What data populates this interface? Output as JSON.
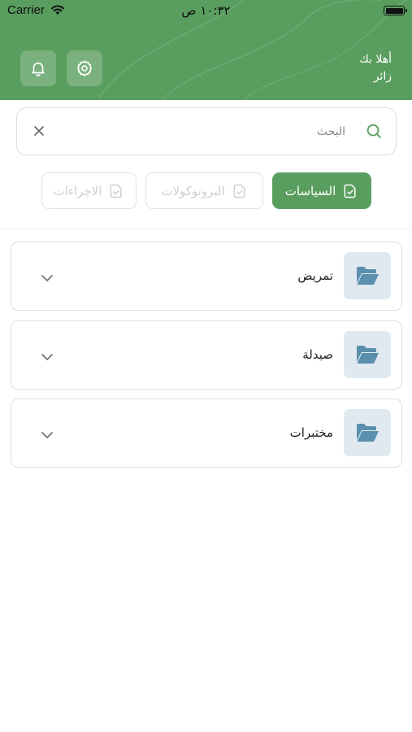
{
  "status_bar": {
    "carrier": "Carrier",
    "time": "١٠:٣٢ ص"
  },
  "header": {
    "greeting_line1": "أهلا بك",
    "greeting_line2": "زائر",
    "accent_color": "#5a9e5f",
    "settings_icon": "gear-icon",
    "notifications_icon": "bell-icon"
  },
  "search": {
    "placeholder": "البحث",
    "value": ""
  },
  "tabs": [
    {
      "label": "السياسات",
      "active": true,
      "icon": "document-check-icon"
    },
    {
      "label": "البروتوكولات",
      "active": false,
      "icon": "document-check-icon"
    },
    {
      "label": "الاجراءات",
      "active": false,
      "icon": "document-check-icon"
    }
  ],
  "categories": [
    {
      "label": "تمريض",
      "icon": "folder-open-icon"
    },
    {
      "label": "صيدلة",
      "icon": "folder-open-icon"
    },
    {
      "label": "مختبرات",
      "icon": "folder-open-icon"
    }
  ]
}
